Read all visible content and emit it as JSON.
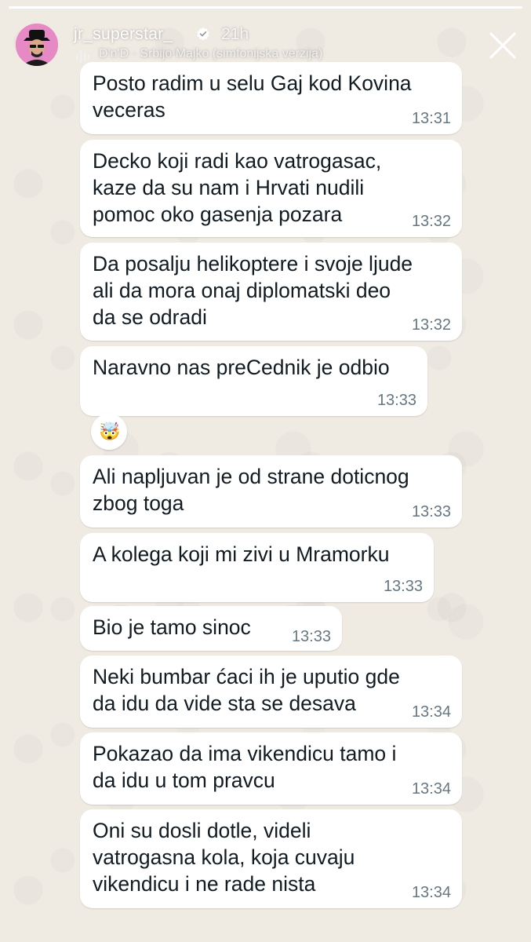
{
  "story": {
    "progress": 1.0,
    "username": "jr_superstar_",
    "time_ago": "21h",
    "music": "D'n'D · Srbijo Majko (simfonijska verzija)",
    "icons": [
      "avatar",
      "verified-badge-icon",
      "music-bars-icon",
      "close-icon"
    ]
  },
  "chat": {
    "messages": [
      {
        "text": "Posto radim u selu Gaj kod Kovina\nveceras",
        "time": "13:31"
      },
      {
        "text": "Decko koji radi kao vatrogasac,\nkaze da su nam i Hrvati nudili\npomoc oko gasenja pozara",
        "time": "13:32"
      },
      {
        "text": "Da posalju helikoptere i svoje ljude\nali da mora onaj diplomatski deo\nda se odradi",
        "time": "13:32"
      },
      {
        "text": "Naravno nas preCednik je odbio",
        "time": "13:33"
      },
      {
        "text": "Ali napljuvan je od strane doticnog\nzbog toga",
        "time": "13:33"
      },
      {
        "text": "A kolega koji mi zivi u Mramorku",
        "time": "13:33"
      },
      {
        "text": "Bio je tamo sinoc",
        "time": "13:33"
      },
      {
        "text": "Neki bumbar ćaci ih je uputio gde\nda idu da vide sta se desava",
        "time": "13:34"
      },
      {
        "text": "Pokazao da ima vikendicu tamo i\nda idu u tom pravcu",
        "time": "13:34"
      },
      {
        "text": "Oni su dosli dotle, videli\nvatrogasna kola, koja cuvaju\nvikendicu i ne rade nista",
        "time": "13:34"
      }
    ],
    "reaction": "🤯"
  }
}
